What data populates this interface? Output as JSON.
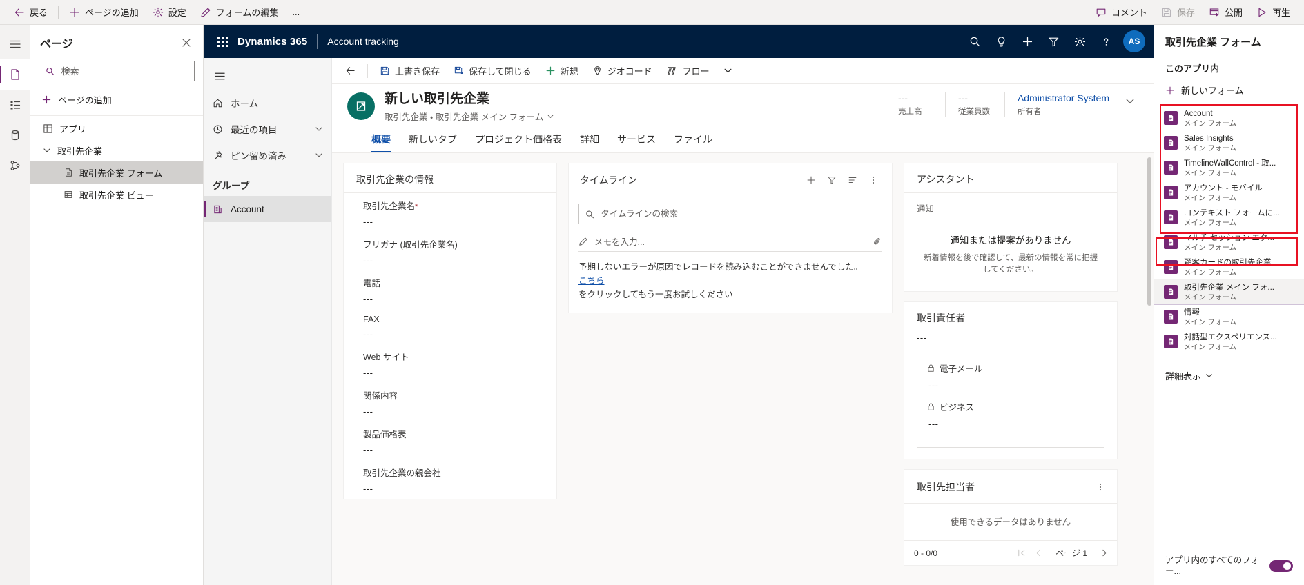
{
  "topbar": {
    "back": "戻る",
    "add_page": "ページの追加",
    "settings": "設定",
    "edit_form": "フォームの編集",
    "overflow": "...",
    "comment": "コメント",
    "save": "保存",
    "publish": "公開",
    "play": "再生"
  },
  "rail": {
    "items": [
      {
        "name": "menu-icon"
      },
      {
        "name": "pages-icon"
      },
      {
        "name": "data-list-icon"
      },
      {
        "name": "data-source-icon"
      },
      {
        "name": "connections-icon"
      }
    ]
  },
  "pages_panel": {
    "title": "ページ",
    "search_placeholder": "検索",
    "search_value": "",
    "add_page": "ページの追加",
    "tree": [
      {
        "label": "アプリ",
        "level": 0,
        "icon": "app-icon",
        "selected": false
      },
      {
        "label": "取引先企業",
        "level": 1,
        "icon": "chevron-down-icon",
        "selected": false
      },
      {
        "label": "取引先企業 フォーム",
        "level": 2,
        "icon": "form-icon",
        "selected": true
      },
      {
        "label": "取引先企業 ビュー",
        "level": 2,
        "icon": "view-icon",
        "selected": false
      }
    ]
  },
  "d365": {
    "brand": "Dynamics 365",
    "app_name": "Account tracking",
    "header_icons": [
      "search-icon",
      "lightbulb-icon",
      "plus-icon",
      "filter-icon",
      "gear-icon",
      "help-icon"
    ],
    "avatar_initials": "AS"
  },
  "sitemap": {
    "items": [
      {
        "label": "ホーム",
        "icon": "home-icon",
        "chevron": false
      },
      {
        "label": "最近の項目",
        "icon": "clock-icon",
        "chevron": true
      },
      {
        "label": "ピン留め済み",
        "icon": "pin-icon",
        "chevron": true
      }
    ],
    "group_label": "グループ",
    "selected_item": "Account"
  },
  "commandbar": {
    "back": "back-arrow-icon",
    "items": [
      {
        "label": "上書き保存",
        "icon": "save-icon"
      },
      {
        "label": "保存して閉じる",
        "icon": "save-close-icon"
      },
      {
        "label": "新規",
        "icon": "plus-icon"
      },
      {
        "label": "ジオコード",
        "icon": "pin-location-icon"
      },
      {
        "label": "フロー",
        "icon": "flow-icon"
      }
    ],
    "overflow_chevron": "chevron-down-icon"
  },
  "form_header": {
    "title": "新しい取引先企業",
    "subtitle": "取引先企業 ・ 取引先企業 メイン フォーム",
    "stats": [
      {
        "value": "---",
        "label": "売上高"
      },
      {
        "value": "---",
        "label": "従業員数"
      }
    ],
    "owner_value": "Administrator System",
    "owner_label": "所有者"
  },
  "tabs": [
    {
      "label": "概要",
      "active": true
    },
    {
      "label": "新しいタブ",
      "active": false
    },
    {
      "label": "プロジェクト価格表",
      "active": false
    },
    {
      "label": "詳細",
      "active": false
    },
    {
      "label": "サービス",
      "active": false
    },
    {
      "label": "ファイル",
      "active": false
    }
  ],
  "account_card": {
    "title": "取引先企業の情報",
    "fields": [
      {
        "label": "取引先企業名",
        "required": true,
        "value": "---"
      },
      {
        "label": "フリガナ (取引先企業名)",
        "required": false,
        "value": "---"
      },
      {
        "label": "電話",
        "required": false,
        "value": "---"
      },
      {
        "label": "FAX",
        "required": false,
        "value": "---"
      },
      {
        "label": "Web サイト",
        "required": false,
        "value": "---"
      },
      {
        "label": "関係内容",
        "required": false,
        "value": "---"
      },
      {
        "label": "製品価格表",
        "required": false,
        "value": "---"
      },
      {
        "label": "取引先企業の親会社",
        "required": false,
        "value": "---"
      }
    ]
  },
  "timeline": {
    "title": "タイムライン",
    "actions": [
      "plus-icon",
      "filter-icon",
      "sort-icon",
      "more-icon"
    ],
    "search_placeholder": "タイムラインの検索",
    "search_value": "",
    "note_placeholder": "メモを入力...",
    "note_icon": "pencil-icon",
    "attach_icon": "paperclip-icon",
    "error_line1": "予期しないエラーが原因でレコードを読み込むことができませんでした。",
    "error_link": "こちら",
    "error_line2": "をクリックしてもう一度お試しください"
  },
  "assistant": {
    "title": "アシスタント",
    "subtitle": "通知",
    "empty_title": "通知または提案がありません",
    "empty_sub": "新着情報を後で確認して、最新の情報を常に把握してください。"
  },
  "primary_contact": {
    "title": "取引責任者",
    "value": "---",
    "email_label": "電子メール",
    "email_value": "---",
    "business_label": "ビジネス",
    "business_value": "---"
  },
  "contacts_grid": {
    "title": "取引先担当者",
    "empty": "使用できるデータはありません",
    "count": "0 - 0/0",
    "page_label": "ページ 1"
  },
  "right_panel": {
    "title": "取引先企業 フォーム",
    "section": "このアプリ内",
    "new_form": "新しいフォーム",
    "forms": [
      {
        "name": "Account",
        "subtitle": "メイン フォーム",
        "selected": false
      },
      {
        "name": "Sales Insights",
        "subtitle": "メイン フォーム",
        "selected": false
      },
      {
        "name": "TimelineWallControl - 取...",
        "subtitle": "メイン フォーム",
        "selected": false
      },
      {
        "name": "アカウント - モバイル",
        "subtitle": "メイン フォーム",
        "selected": false
      },
      {
        "name": "コンテキスト フォームに...",
        "subtitle": "メイン フォーム",
        "selected": false
      },
      {
        "name": "マルチ セッション エク...",
        "subtitle": "メイン フォーム",
        "selected": false
      },
      {
        "name": "顧客カードの取引先企業...",
        "subtitle": "メイン フォーム",
        "selected": false
      },
      {
        "name": "取引先企業 メイン フォ...",
        "subtitle": "メイン フォーム",
        "selected": true
      },
      {
        "name": "情報",
        "subtitle": "メイン フォーム",
        "selected": false
      },
      {
        "name": "対話型エクスペリエンス...",
        "subtitle": "メイン フォーム",
        "selected": false
      }
    ],
    "more": "詳細表示",
    "bottom_label": "アプリ内のすべてのフォー..."
  },
  "colors": {
    "accent": "#742774",
    "d365_header": "#001e3f",
    "link": "#0f4fa8",
    "required": "#a4262c",
    "highlight_box": "#e81123",
    "form_icon": "#086f64"
  }
}
